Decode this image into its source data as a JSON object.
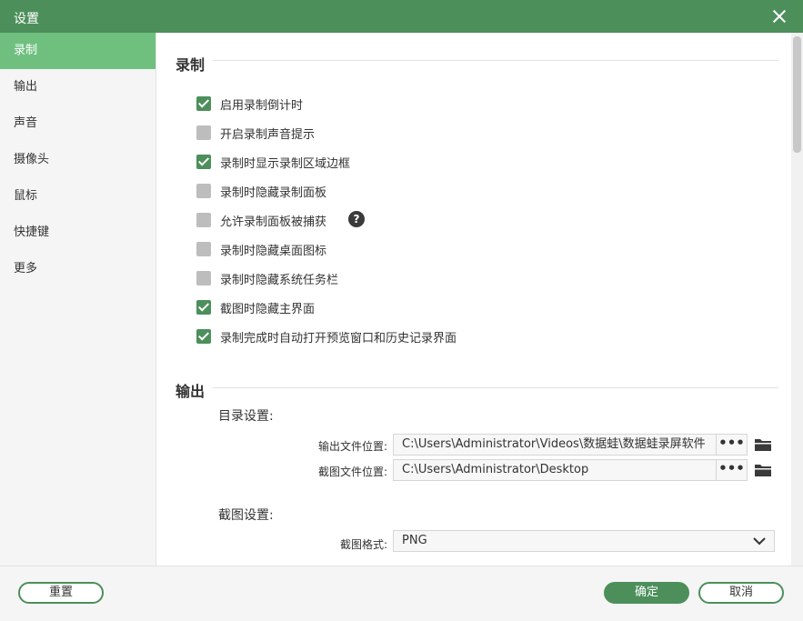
{
  "window": {
    "title": "设置"
  },
  "sidebar": {
    "items": [
      {
        "label": "录制"
      },
      {
        "label": "输出"
      },
      {
        "label": "声音"
      },
      {
        "label": "摄像头"
      },
      {
        "label": "鼠标"
      },
      {
        "label": "快捷键"
      },
      {
        "label": "更多"
      }
    ],
    "active_index": 0
  },
  "record": {
    "title": "录制",
    "options": [
      {
        "label": "启用录制倒计时",
        "checked": true
      },
      {
        "label": "开启录制声音提示",
        "checked": false
      },
      {
        "label": "录制时显示录制区域边框",
        "checked": true
      },
      {
        "label": "录制时隐藏录制面板",
        "checked": false
      },
      {
        "label": "允许录制面板被捕获",
        "checked": false
      },
      {
        "label": "录制时隐藏桌面图标",
        "checked": false
      },
      {
        "label": "录制时隐藏系统任务栏",
        "checked": false
      },
      {
        "label": "截图时隐藏主界面",
        "checked": true
      },
      {
        "label": "录制完成时自动打开预览窗口和历史记录界面",
        "checked": true
      }
    ],
    "help_glyph": "?"
  },
  "output": {
    "title": "输出",
    "dir_title": "目录设置:",
    "output_label": "输出文件位置:",
    "output_path": "C:\\Users\\Administrator\\Videos\\数据蛙\\数据蛙录屏软件",
    "screenshot_label": "截图文件位置:",
    "screenshot_path": "C:\\Users\\Administrator\\Desktop",
    "browse_glyph": "•••",
    "capture_title": "截图设置:",
    "format_label": "截图格式:",
    "format_value": "PNG"
  },
  "footer": {
    "reset_label": "重置",
    "ok_label": "确定",
    "cancel_label": "取消"
  },
  "colors": {
    "accent": "#4c8f5b",
    "sidebar_active": "#6fc07f"
  }
}
